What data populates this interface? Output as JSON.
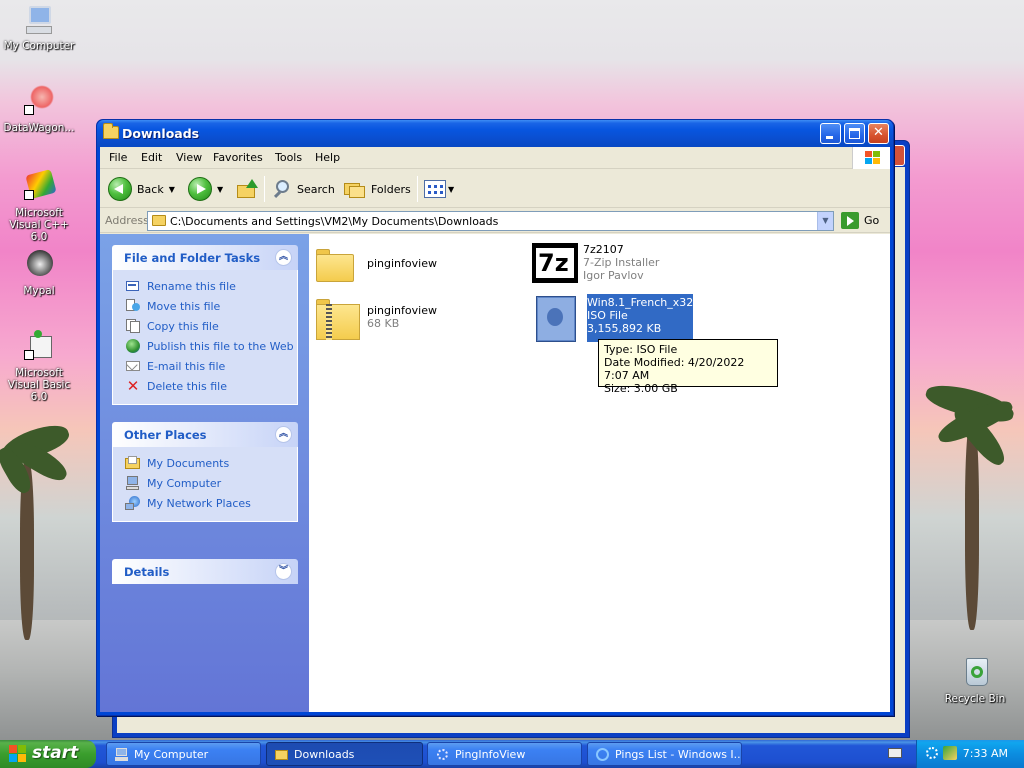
{
  "desktop": {
    "icons": [
      {
        "label": "My Computer"
      },
      {
        "label": "DataWagon..."
      },
      {
        "label": "Microsoft Visual C++ 6.0"
      },
      {
        "label": "Mypal"
      },
      {
        "label": "Microsoft Visual Basic 6.0"
      },
      {
        "label": "Recycle Bin"
      }
    ]
  },
  "window": {
    "title": "Downloads",
    "menu": [
      "File",
      "Edit",
      "View",
      "Favorites",
      "Tools",
      "Help"
    ],
    "toolbar": {
      "back": "Back",
      "search": "Search",
      "folders": "Folders"
    },
    "address": {
      "label": "Address",
      "path": "C:\\Documents and Settings\\VM2\\My Documents\\Downloads",
      "go": "Go"
    }
  },
  "taskpane": {
    "file_tasks": {
      "title": "File and Folder Tasks",
      "items": [
        {
          "label": "Rename this file",
          "icon": "rename-icon"
        },
        {
          "label": "Move this file",
          "icon": "move-icon"
        },
        {
          "label": "Copy this file",
          "icon": "copy-icon"
        },
        {
          "label": "Publish this file to the Web",
          "icon": "web-publish-icon"
        },
        {
          "label": "E-mail this file",
          "icon": "email-icon"
        },
        {
          "label": "Delete this file",
          "icon": "delete-icon"
        }
      ]
    },
    "other_places": {
      "title": "Other Places",
      "items": [
        {
          "label": "My Documents",
          "icon": "my-documents-icon"
        },
        {
          "label": "My Computer",
          "icon": "my-computer-icon"
        },
        {
          "label": "My Network Places",
          "icon": "network-places-icon"
        }
      ]
    },
    "details": {
      "title": "Details"
    }
  },
  "files": [
    {
      "name": "pinginfoview",
      "line2": "",
      "line3": "",
      "icon": "folder-icon"
    },
    {
      "name": "7z2107",
      "line2": "7-Zip Installer",
      "line3": "Igor Pavlov",
      "icon": "7zip-icon"
    },
    {
      "name": "pinginfoview",
      "line2": "68 KB",
      "line3": "",
      "icon": "zip-folder-icon"
    },
    {
      "name": "Win8.1_French_x32",
      "line2": "ISO File",
      "line3": "3,155,892 KB",
      "icon": "iso-file-icon",
      "selected": true
    }
  ],
  "tooltip": {
    "type": "Type: ISO File",
    "modified": "Date Modified: 4/20/2022 7:07 AM",
    "size": "Size: 3.00 GB"
  },
  "taskbar": {
    "start": "start",
    "tasks": [
      {
        "label": "My Computer",
        "active": false
      },
      {
        "label": "Downloads",
        "active": true
      },
      {
        "label": "PingInfoView",
        "active": false
      },
      {
        "label": "Pings List - Windows I...",
        "active": false
      }
    ],
    "clock": "7:33 AM"
  },
  "colors": {
    "titlebar": "#0a4ecf",
    "taskpane_link": "#215dc6",
    "selection": "#316ac5",
    "start_green": "#3a9e2d"
  }
}
